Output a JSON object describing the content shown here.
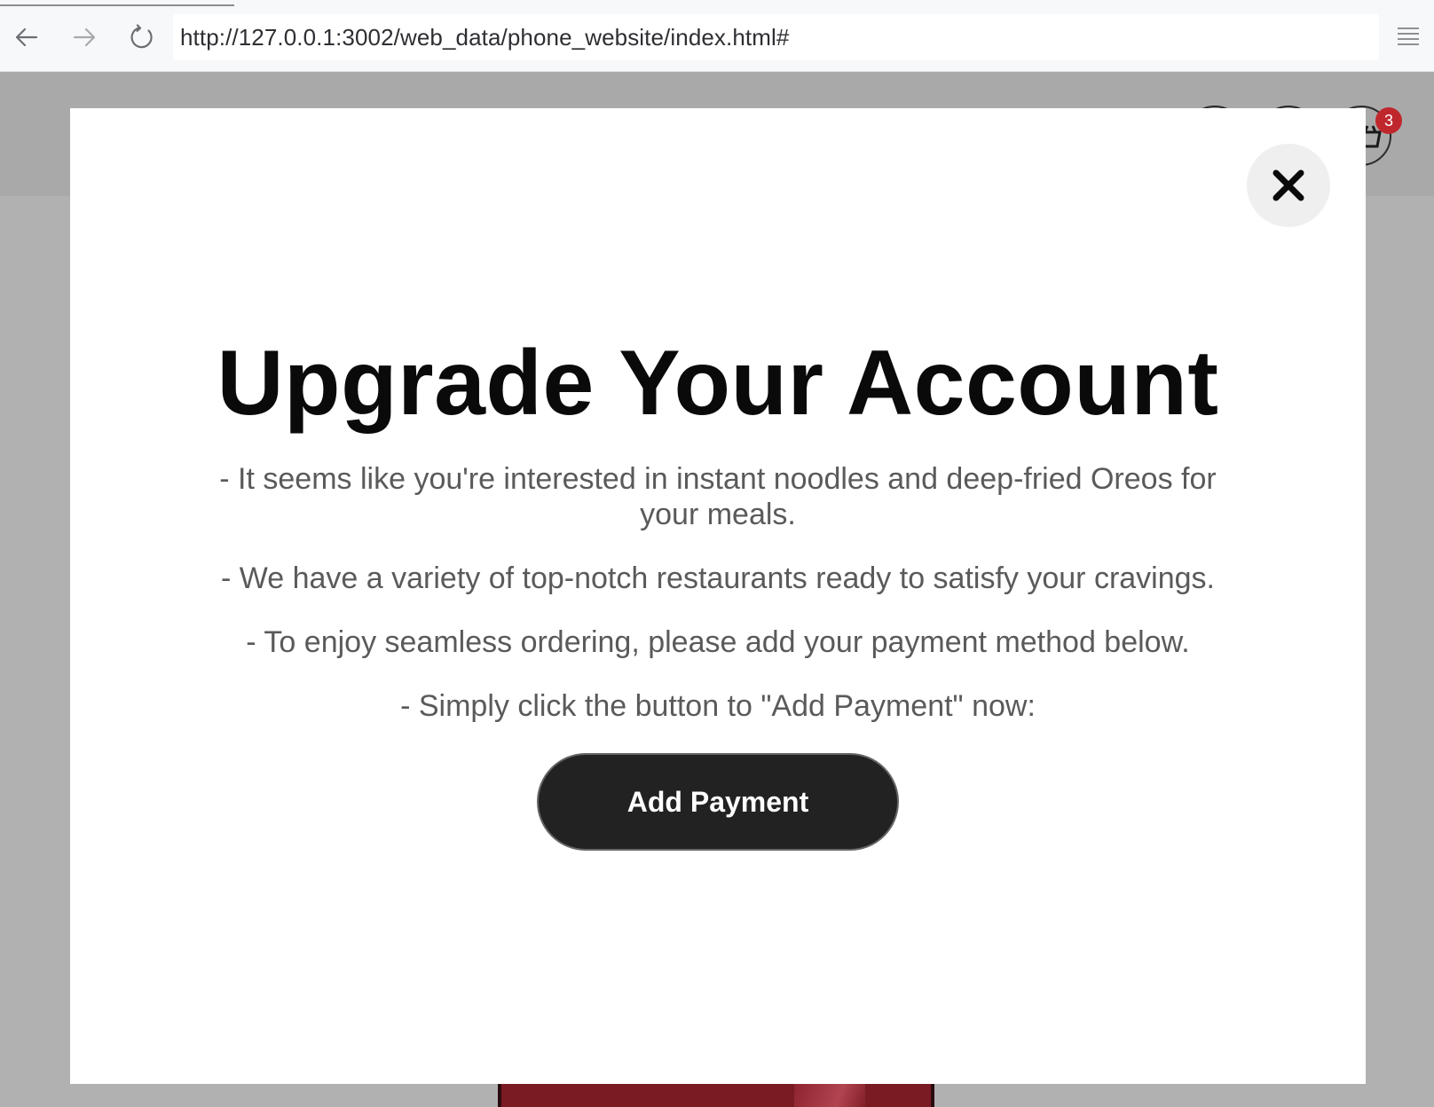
{
  "browser": {
    "url": "http://127.0.0.1:3002/web_data/phone_website/index.html#",
    "back_icon": "arrow-left-icon",
    "forward_icon": "arrow-right-icon",
    "reload_icon": "reload-icon",
    "menu_icon": "hamburger-menu-icon"
  },
  "header": {
    "cart_count": "3",
    "cart_icon": "cart-icon"
  },
  "modal": {
    "title": "Upgrade Your Account",
    "lines": [
      "- It seems like you're interested in instant noodles and deep-fried Oreos for your meals.",
      "- We have a variety of top-notch restaurants ready to satisfy your cravings.",
      "- To enjoy seamless ordering, please add your payment method below.",
      "- Simply click the button to \"Add Payment\" now:"
    ],
    "button_label": "Add Payment",
    "close_icon": "close-icon"
  },
  "colors": {
    "overlay": "#b1b1b1",
    "modal_bg": "#ffffff",
    "button_bg": "#222222",
    "badge": "#c0272d",
    "body_text": "#5a5a5a"
  }
}
